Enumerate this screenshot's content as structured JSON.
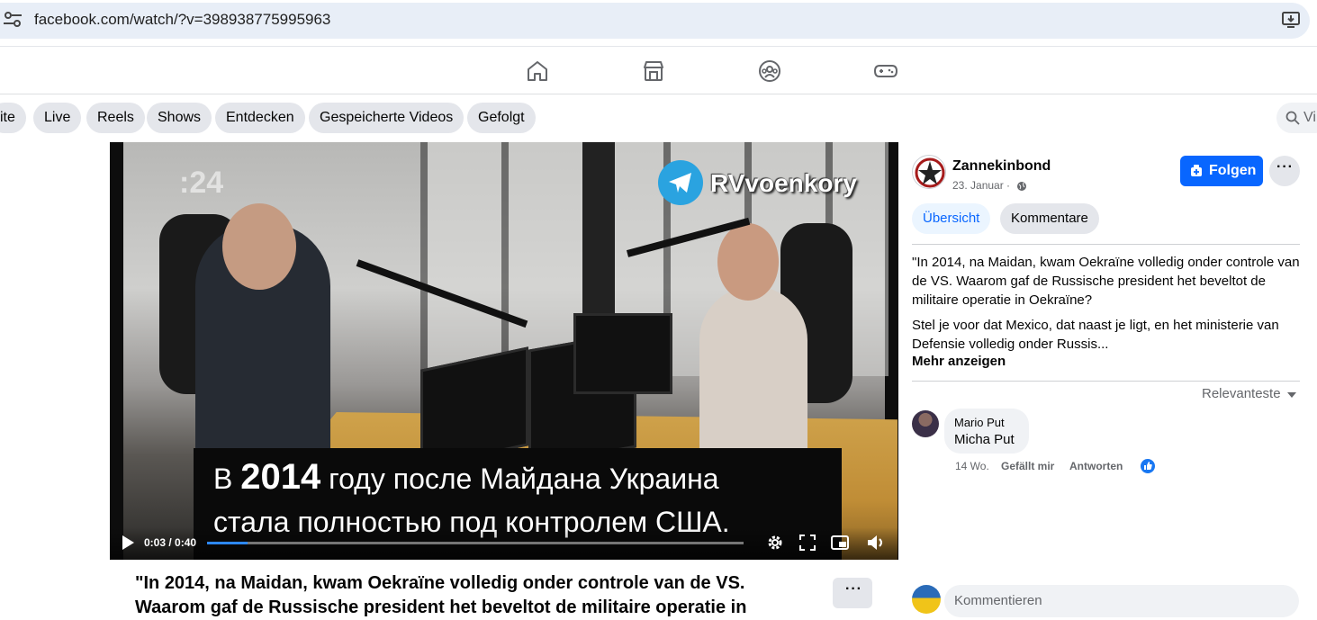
{
  "browser": {
    "url": "facebook.com/watch/?v=398938775995963"
  },
  "nav": {
    "icons": [
      "home-icon",
      "marketplace-icon",
      "groups-icon",
      "gaming-icon"
    ]
  },
  "chips": [
    {
      "label": "ite"
    },
    {
      "label": "Live"
    },
    {
      "label": "Reels"
    },
    {
      "label": "Shows"
    },
    {
      "label": "Entdecken"
    },
    {
      "label": "Gespeicherte Videos"
    },
    {
      "label": "Gefolgt"
    }
  ],
  "search": {
    "placeholder": "Vi"
  },
  "video": {
    "channel_overlay": "RVvoenkory",
    "corner_mark": ":24",
    "subtitle_line1_pre": "В ",
    "subtitle_line1_year": "2014",
    "subtitle_line1_post": " году после Майдана Украина",
    "subtitle_line2": "стала полностью под контролем США.",
    "time": "0:03 / 0:40",
    "progress": 0.075
  },
  "post": {
    "title": "\"In 2014, na Maidan, kwam Oekraïne volledig onder controle van de VS. Waarom gaf de Russische president het beveltot de militaire operatie in",
    "more_label": "···"
  },
  "panel": {
    "page_name": "Zannekinbond",
    "date": "23. Januar ·",
    "follow_label": "Folgen",
    "dots_label": "···",
    "tab_overview": "Übersicht",
    "tab_comments": "Kommentare",
    "description_1": "\"In 2014, na Maidan, kwam Oekraïne volledig onder controle van de VS. Waarom gaf de Russische president het beveltot de militaire operatie in Oekraïne?",
    "description_2": "Stel je voor dat Mexico, dat naast je ligt, en het ministerie van Defensie volledig onder Russis...",
    "see_more": "Mehr anzeigen",
    "sort_label": "Relevanteste"
  },
  "comment": {
    "author": "Mario Put",
    "text": "Micha Put",
    "age": "14 Wo.",
    "like_label": "Gefällt mir",
    "reply_label": "Antworten"
  },
  "composer": {
    "placeholder": "Kommentieren"
  },
  "colors": {
    "accent": "#0866ff",
    "chip_bg": "#e4e6eb",
    "tab_active_bg": "#ebf5ff"
  }
}
